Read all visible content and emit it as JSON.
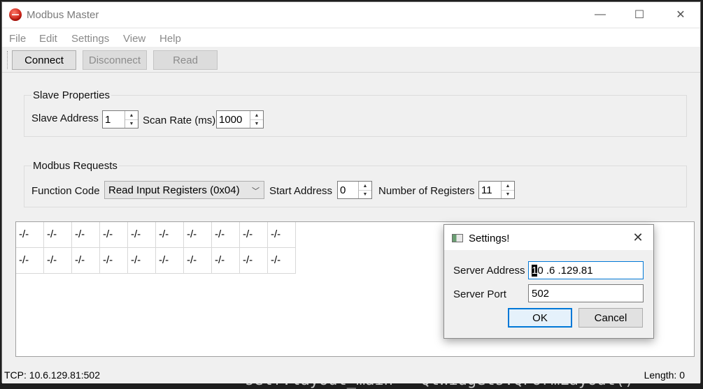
{
  "background_code": "self.layout_main = QtWidgets.QFormLayout()",
  "window": {
    "title": "Modbus Master",
    "minimize_glyph": "—",
    "maximize_glyph": "☐",
    "close_glyph": "✕"
  },
  "menu": {
    "items": [
      "File",
      "Edit",
      "Settings",
      "View",
      "Help"
    ]
  },
  "toolbar": {
    "connect_label": "Connect",
    "disconnect_label": "Disconnect",
    "read_label": "Read"
  },
  "slave_properties": {
    "title": "Slave Properties",
    "slave_address_label": "Slave Address",
    "slave_address_value": "1",
    "scan_rate_label": "Scan Rate (ms)",
    "scan_rate_value": "1000"
  },
  "modbus_requests": {
    "title": "Modbus Requests",
    "function_code_label": "Function Code",
    "function_code_value": "Read Input Registers (0x04)",
    "start_address_label": "Start Address",
    "start_address_value": "0",
    "num_registers_label": "Number of Registers",
    "num_registers_value": "11"
  },
  "table": {
    "rows": [
      [
        "-/-",
        "-/-",
        "-/-",
        "-/-",
        "-/-",
        "-/-",
        "-/-",
        "-/-",
        "-/-",
        "-/-"
      ],
      [
        "-/-",
        "-/-",
        "-/-",
        "-/-",
        "-/-",
        "-/-",
        "-/-",
        "-/-",
        "-/-",
        "-/-"
      ]
    ]
  },
  "statusbar": {
    "connection": "TCP: 10.6.129.81:502",
    "length": "Length: 0"
  },
  "dialog": {
    "title": "Settings!",
    "server_address_label": "Server Address",
    "server_address_first_char": "1",
    "server_address_rest": "0 .6  .129.81",
    "server_port_label": "Server Port",
    "server_port_value": "502",
    "ok_label": "OK",
    "cancel_label": "Cancel"
  },
  "colors": {
    "accent": "#0078d7",
    "window_bg": "#f0f0f0",
    "desktop_bg": "#1e1e1e"
  }
}
